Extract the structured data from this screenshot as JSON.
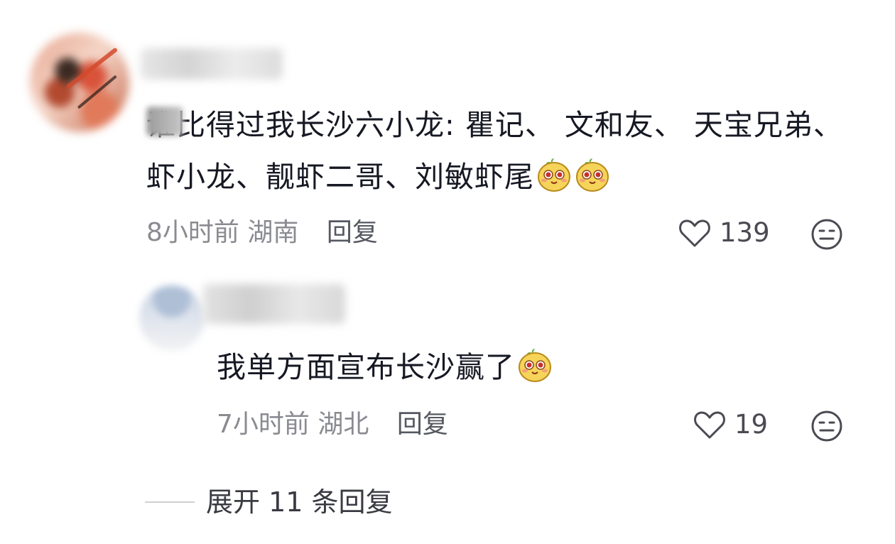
{
  "comment": {
    "text": "谁比得过我长沙六小龙: 瞿记、 文和友、 天宝兄弟、 虾小龙、靓虾二哥、刘敏虾尾",
    "emojis": [
      "smile-face-emoji",
      "smile-face-emoji"
    ],
    "time": "8小时前",
    "location": "湖南",
    "reply_label": "回复",
    "likes": "139"
  },
  "reply": {
    "text": "我单方面宣布长沙赢了",
    "emojis": [
      "smile-face-emoji"
    ],
    "time": "7小时前",
    "location": "湖北",
    "reply_label": "回复",
    "likes": "19"
  },
  "expand": {
    "label": "展开 11 条回复"
  },
  "icons": {
    "like": "heart-outline-icon",
    "dislike": "neutral-face-icon"
  }
}
